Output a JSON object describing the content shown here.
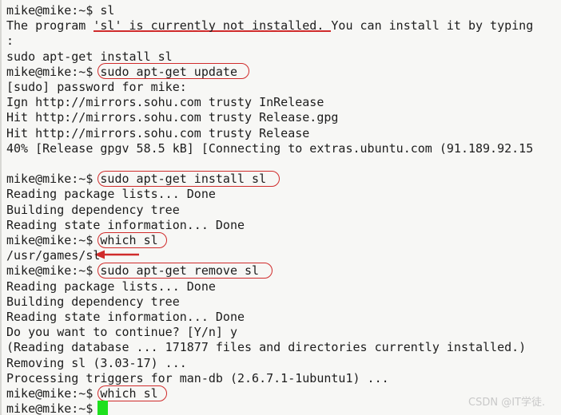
{
  "terminal": {
    "background_color": "#f7f7f5",
    "text_color": "#1c1c1c",
    "annotation_color": "#d02b2b",
    "cursor_color": "#1ee01e",
    "prompt": "mike@mike:~$ ",
    "lines": [
      {
        "id": 0,
        "text": "mike@mike:~$ sl"
      },
      {
        "id": 1,
        "text": "The program 'sl' is currently not installed. You can install it by typing"
      },
      {
        "id": 2,
        "text": ":"
      },
      {
        "id": 3,
        "text": "sudo apt-get install sl"
      },
      {
        "id": 4,
        "text": "mike@mike:~$ sudo apt-get update"
      },
      {
        "id": 5,
        "text": "[sudo] password for mike:"
      },
      {
        "id": 6,
        "text": "Ign http://mirrors.sohu.com trusty InRelease"
      },
      {
        "id": 7,
        "text": "Hit http://mirrors.sohu.com trusty Release.gpg"
      },
      {
        "id": 8,
        "text": "Hit http://mirrors.sohu.com trusty Release"
      },
      {
        "id": 9,
        "text": "40% [Release gpgv 58.5 kB] [Connecting to extras.ubuntu.com (91.189.92.15"
      },
      {
        "id": 10,
        "text": ""
      },
      {
        "id": 11,
        "text": "mike@mike:~$ sudo apt-get install sl"
      },
      {
        "id": 12,
        "text": "Reading package lists... Done"
      },
      {
        "id": 13,
        "text": "Building dependency tree"
      },
      {
        "id": 14,
        "text": "Reading state information... Done"
      },
      {
        "id": 15,
        "text": "mike@mike:~$ which sl"
      },
      {
        "id": 16,
        "text": "/usr/games/sl"
      },
      {
        "id": 17,
        "text": "mike@mike:~$ sudo apt-get remove sl"
      },
      {
        "id": 18,
        "text": "Reading package lists... Done"
      },
      {
        "id": 19,
        "text": "Building dependency tree"
      },
      {
        "id": 20,
        "text": "Reading state information... Done"
      },
      {
        "id": 21,
        "text": "Do you want to continue? [Y/n] y"
      },
      {
        "id": 22,
        "text": "(Reading database ... 171877 files and directories currently installed.)"
      },
      {
        "id": 23,
        "text": "Removing sl (3.03-17) ..."
      },
      {
        "id": 24,
        "text": "Processing triggers for man-db (2.6.7.1-1ubuntu1) ..."
      },
      {
        "id": 25,
        "text": "mike@mike:~$ which sl"
      },
      {
        "id": 26,
        "text": "mike@mike:~$ "
      }
    ],
    "annotations": {
      "underline_label": "is currently not installed.",
      "boxes": [
        {
          "label": "sudo apt-get update"
        },
        {
          "label": "sudo apt-get install sl"
        },
        {
          "label": "which sl"
        },
        {
          "label": "sudo apt-get remove sl"
        },
        {
          "label": "which sl"
        }
      ],
      "arrow_label": "points-to /usr/games/sl"
    },
    "watermark": "CSDN @IT学徒."
  }
}
